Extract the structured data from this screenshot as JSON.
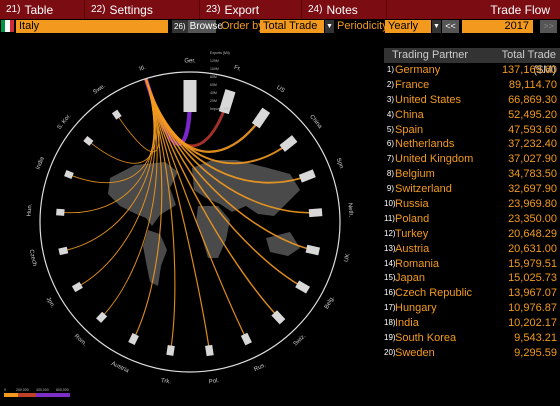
{
  "menu": {
    "items": [
      {
        "num": "21)",
        "label": "Table"
      },
      {
        "num": "22)",
        "label": "Settings"
      },
      {
        "num": "23)",
        "label": "Export"
      },
      {
        "num": "24)",
        "label": "Notes"
      }
    ],
    "title": "Trade Flow"
  },
  "controls": {
    "country": "Italy",
    "browse_num": "26)",
    "browse_label": "Browse",
    "order_label": "Order by",
    "order_value": "Total Trade",
    "periodicity_label": "Periodicity",
    "periodicity_value": "Yearly",
    "prev_label": "<<",
    "year_value": "2017",
    "next_label": ">>"
  },
  "colors": {
    "accent": "#f39a1e",
    "menu_bg": "#7a0c12",
    "flag": [
      "#009246",
      "#ffffff",
      "#ce2b37"
    ]
  },
  "table": {
    "headers": [
      "Trading Partner",
      "Total Trade ($M)"
    ],
    "rows": [
      {
        "rank": "1)",
        "partner": "Germany",
        "value": "137,169.60"
      },
      {
        "rank": "2)",
        "partner": "France",
        "value": "89,114.70"
      },
      {
        "rank": "3)",
        "partner": "United States",
        "value": "66,869.30"
      },
      {
        "rank": "4)",
        "partner": "China",
        "value": "52,495.20"
      },
      {
        "rank": "5)",
        "partner": "Spain",
        "value": "47,593.60"
      },
      {
        "rank": "6)",
        "partner": "Netherlands",
        "value": "37,232.40"
      },
      {
        "rank": "7)",
        "partner": "United Kingdom",
        "value": "37,027.90"
      },
      {
        "rank": "8)",
        "partner": "Belgium",
        "value": "34,783.50"
      },
      {
        "rank": "9)",
        "partner": "Switzerland",
        "value": "32,697.90"
      },
      {
        "rank": "10)",
        "partner": "Russia",
        "value": "23,969.80"
      },
      {
        "rank": "11)",
        "partner": "Poland",
        "value": "23,350.00"
      },
      {
        "rank": "12)",
        "partner": "Turkey",
        "value": "20,648.29"
      },
      {
        "rank": "13)",
        "partner": "Austria",
        "value": "20,631.00"
      },
      {
        "rank": "14)",
        "partner": "Romania",
        "value": "15,979.51"
      },
      {
        "rank": "15)",
        "partner": "Japan",
        "value": "15,025.73"
      },
      {
        "rank": "16)",
        "partner": "Czech Republic",
        "value": "13,967.07"
      },
      {
        "rank": "17)",
        "partner": "Hungary",
        "value": "10,976.87"
      },
      {
        "rank": "18)",
        "partner": "India",
        "value": "10,202.17"
      },
      {
        "rank": "19)",
        "partner": "South Korea",
        "value": "9,543.21"
      },
      {
        "rank": "20)",
        "partner": "Sweden",
        "value": "9,295.59"
      }
    ]
  },
  "radial": {
    "country_labels": [
      "Ger.",
      "Fr.",
      "US",
      "China",
      "Spn",
      "Neth.",
      "UK",
      "Belg.",
      "Swiz.",
      "Rus.",
      "Pol.",
      "Trk.",
      "Austria",
      "Rom.",
      "Jpn.",
      "Czech",
      "Hun.",
      "India",
      "S. Kor.",
      "Swe.",
      "Itl."
    ],
    "partner_totals": [
      137169.6,
      89114.7,
      66869.3,
      52495.2,
      47593.6,
      37232.4,
      37027.9,
      34783.5,
      32697.9,
      23969.8,
      23350.0,
      20648.29,
      20631.0,
      15979.51,
      15025.73,
      13967.07,
      10976.87,
      10202.17,
      9543.21,
      9295.59
    ],
    "scale_labels": [
      "Exports (Mil)",
      "120M",
      "100M",
      "80M",
      "60M",
      "40M",
      "20M",
      "Imports (Mil)"
    ]
  },
  "legend_ticks": [
    "0",
    "200,000",
    "400,000",
    "600,000"
  ]
}
